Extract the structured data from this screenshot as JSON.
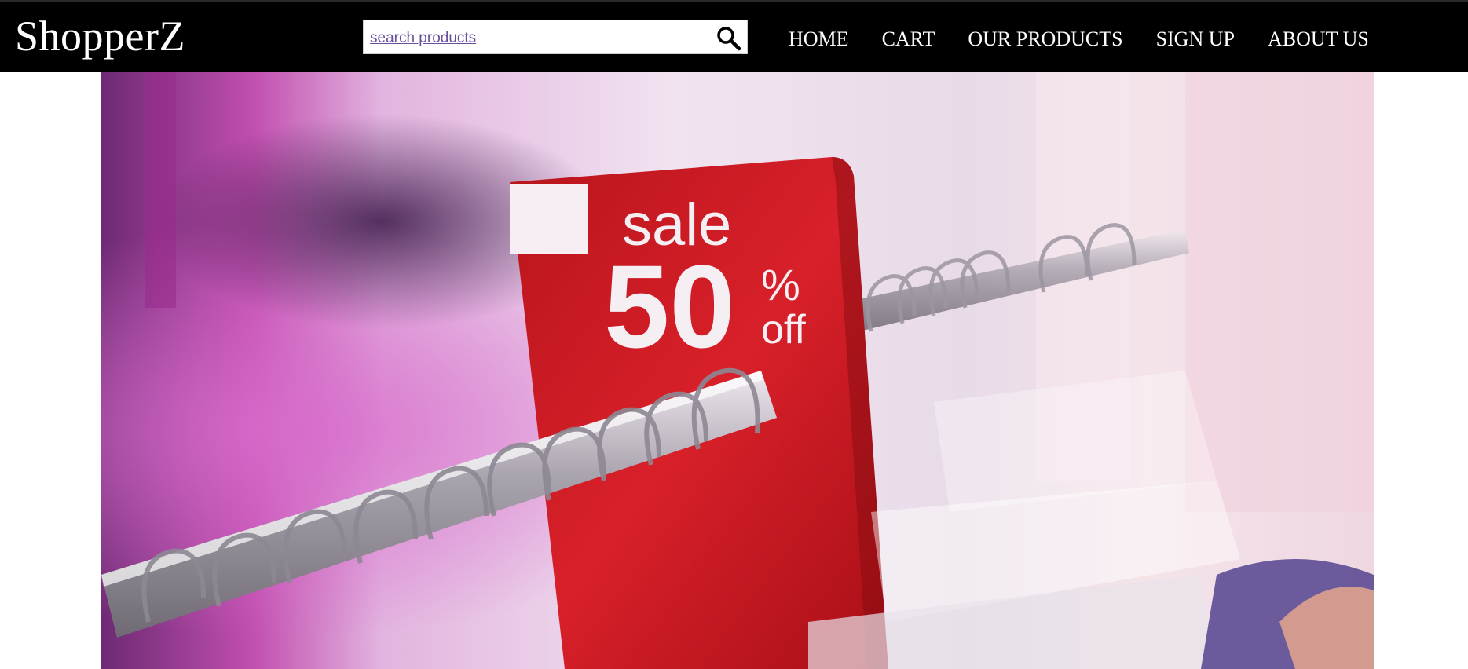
{
  "header": {
    "logo": "ShopperZ",
    "search": {
      "placeholder": "search products"
    },
    "nav": [
      "HOME",
      "CART",
      "OUR PRODUCTS",
      "SIGN UP",
      "ABOUT US"
    ]
  },
  "hero": {
    "sign": {
      "line1": "sale",
      "big": "50",
      "pct": "%",
      "off": "off"
    }
  },
  "colors": {
    "header_bg": "#000000",
    "header_text": "#ffffff",
    "sale_red": "#c4161c"
  },
  "icons": [
    "search-icon"
  ]
}
